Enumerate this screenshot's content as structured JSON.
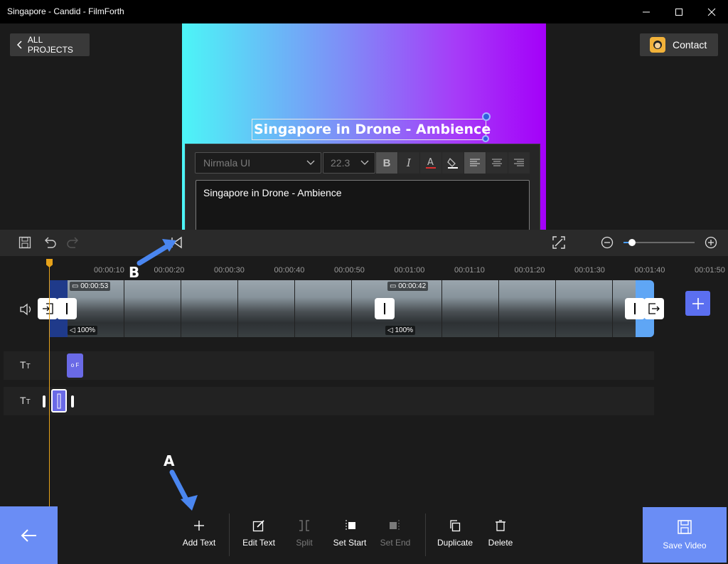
{
  "window": {
    "title": "Singapore - Candid - FilmForth"
  },
  "header": {
    "all_projects_label": "ALL PROJECTS",
    "contact_label": "Contact"
  },
  "preview": {
    "title_text": "Singapore in Drone - Ambience"
  },
  "text_editor": {
    "font": "Nirmala UI",
    "size": "22.3",
    "text": "Singapore in Drone - Ambience",
    "alignment": "left"
  },
  "timeline": {
    "ticks": [
      "00:00:10",
      "00:00:20",
      "00:00:30",
      "00:00:40",
      "00:00:50",
      "00:01:00",
      "00:01:10",
      "00:01:20",
      "00:01:30",
      "00:01:40",
      "00:01:50"
    ],
    "clips": [
      {
        "duration": "00:00:53",
        "volume": "100%"
      },
      {
        "duration": "00:00:42",
        "volume": "100%"
      }
    ],
    "text_track_1_clip": "o F",
    "zoom_percent": 12
  },
  "bottom_tools": {
    "add_text": "Add Text",
    "edit_text": "Edit Text",
    "split": "Split",
    "set_start": "Set Start",
    "set_end": "Set End",
    "duplicate": "Duplicate",
    "delete": "Delete",
    "save_video": "Save Video"
  },
  "annotations": {
    "a": "A",
    "b": "B"
  },
  "colors": {
    "accent": "#6a8df5",
    "text_clip": "#6a6ae6",
    "playhead": "#e6a21a"
  }
}
